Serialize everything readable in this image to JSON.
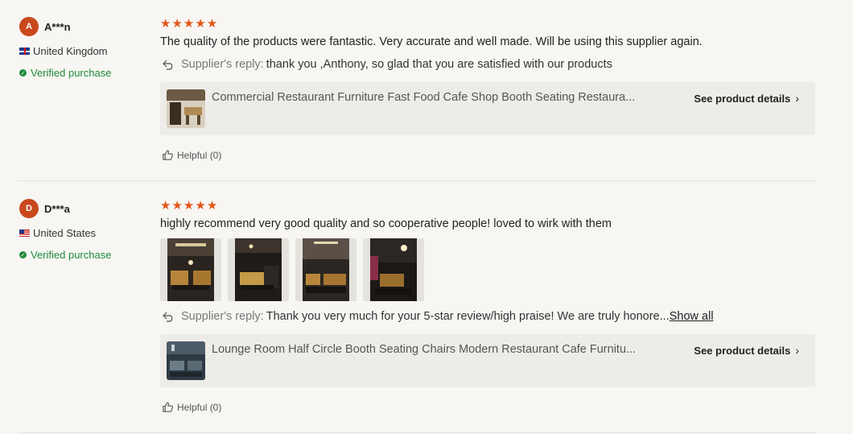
{
  "reviews": [
    {
      "avatar_letter": "A",
      "name": "A***n",
      "country": "United Kingdom",
      "flag": "uk-flag-icon",
      "verified": "Verified purchase",
      "rating": 5,
      "text": "The quality of the products were fantastic. Very accurate and well made. Will be using this supplier again.",
      "reply_label": "Supplier's reply:",
      "reply_text": "thank you ,Anthony, so glad that you are satisfied with our products",
      "product_title": "Commercial Restaurant Furniture Fast Food Cafe Shop Booth Seating Restaura...",
      "see_details": "See product details",
      "helpful": "Helpful (0)"
    },
    {
      "avatar_letter": "D",
      "name": "D***a",
      "country": "United States",
      "flag": "us-flag-icon",
      "verified": "Verified purchase",
      "rating": 5,
      "text": "highly recommend very good quality and so cooperative people! loved to wirk with them",
      "photos": [
        "review-photo-1",
        "review-photo-2",
        "review-photo-3",
        "review-photo-4"
      ],
      "reply_label": "Supplier's reply:",
      "reply_text": "Thank you very much for your 5-star review/high praise! We are truly honore...",
      "show_all": "Show all",
      "product_title": "Lounge Room Half Circle Booth Seating Chairs Modern Restaurant Cafe Furnitu...",
      "see_details": "See product details",
      "helpful": "Helpful (0)"
    }
  ],
  "colors": {
    "star": "#e2571b",
    "avatar": "#c9491d",
    "verified": "#1f8a3b",
    "card_bg": "#edece8",
    "page_bg": "#f7f6f3"
  }
}
